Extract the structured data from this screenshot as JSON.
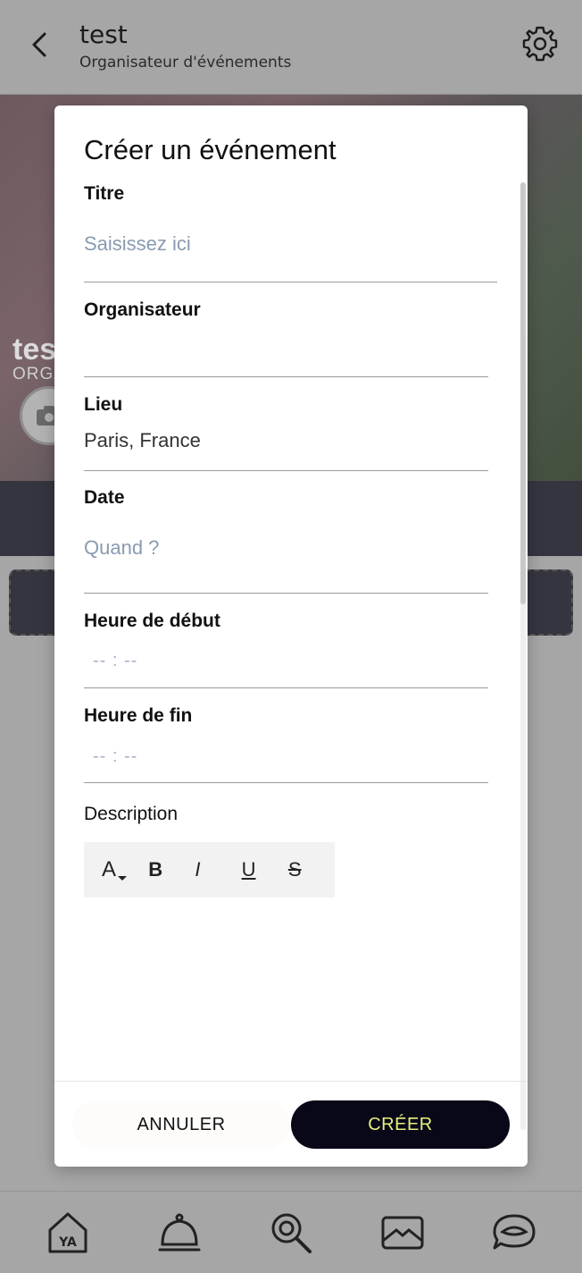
{
  "header": {
    "title": "test",
    "subtitle": "Organisateur d'événements"
  },
  "cover": {
    "name": "tes",
    "role": "ORGA"
  },
  "modal": {
    "title": "Créer un événement",
    "fields": {
      "titre": {
        "label": "Titre",
        "placeholder": "Saisissez ici",
        "value": ""
      },
      "organisateur": {
        "label": "Organisateur",
        "value": ""
      },
      "lieu": {
        "label": "Lieu",
        "value": "Paris, France"
      },
      "date": {
        "label": "Date",
        "placeholder": "Quand ?",
        "value": ""
      },
      "heure_debut": {
        "label": "Heure de début",
        "placeholder": "-- : --"
      },
      "heure_fin": {
        "label": "Heure de fin",
        "placeholder": "-- : --"
      }
    },
    "description": {
      "label": "Description",
      "toolbar": {
        "font": "A",
        "bold": "B",
        "italic": "I",
        "underline": "U",
        "strike": "S"
      }
    },
    "buttons": {
      "cancel": "ANNULER",
      "create": "CRÉER"
    }
  },
  "bottom_nav": {
    "items": [
      "home-icon",
      "service-bell-icon",
      "search-icon",
      "mail-icon",
      "chat-icon"
    ]
  },
  "colors": {
    "primary_button": "#080819",
    "primary_button_text": "#e8f07a",
    "placeholder": "#8a9bb0"
  }
}
